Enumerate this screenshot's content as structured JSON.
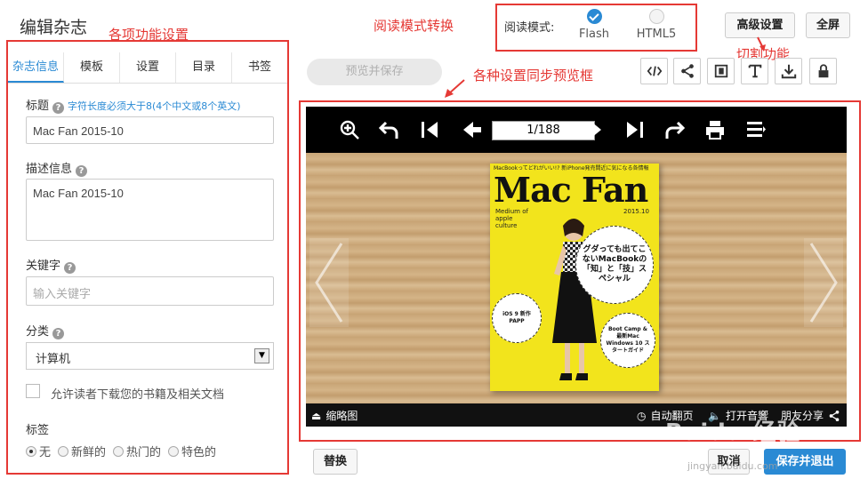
{
  "header": {
    "title": "编辑杂志",
    "advanced_settings": "高级设置",
    "fullscreen": "全屏"
  },
  "annotations": {
    "settings": "各项功能设置",
    "read_mode_switch": "阅读模式转换",
    "preview_sync": "各种设置同步预览框",
    "cut_function": "切割功能"
  },
  "read_mode": {
    "label": "阅读模式:",
    "options": [
      {
        "label": "Flash",
        "checked": true
      },
      {
        "label": "HTML5",
        "checked": false
      }
    ]
  },
  "tabs": [
    {
      "label": "杂志信息",
      "active": true
    },
    {
      "label": "模板",
      "active": false
    },
    {
      "label": "设置",
      "active": false
    },
    {
      "label": "目录",
      "active": false
    },
    {
      "label": "书签",
      "active": false
    }
  ],
  "form": {
    "title_label": "标题",
    "title_hint": "字符长度必须大于8(4个中文或8个英文)",
    "title_value": "Mac Fan 2015-10",
    "desc_label": "描述信息",
    "desc_value": "Mac Fan 2015-10",
    "keyword_label": "关键字",
    "keyword_placeholder": "输入关键字",
    "category_label": "分类",
    "category_value": "计算机",
    "allow_download": "允许读者下载您的书籍及相关文档",
    "tag_label": "标签",
    "tag_options": [
      "无",
      "新鲜的",
      "热门的",
      "特色的"
    ]
  },
  "toolbar": {
    "preview_save": "预览并保存"
  },
  "viewer": {
    "page_counter": "1/188",
    "thumbnails": "缩略图",
    "auto_flip": "自动翻页",
    "open_sound": "打开音響",
    "share": "朋友分享"
  },
  "magazine": {
    "top_line": "MacBookってどれがいい!? 新iPhone発売間近に気になる各情報",
    "title": "Mac Fan",
    "subtitle": "Medium of apple culture",
    "date": "2015.10",
    "circle_main": "グダっても出てこないMacBookの「知」と「技」スペシャル",
    "circle_left": "iOS 9 新作PAPP",
    "circle_right": "Boot Camp & 最新Mac Windows 10 スタートガイド"
  },
  "footer": {
    "replace": "替换",
    "cancel": "取消",
    "save_exit": "保存并退出"
  },
  "watermark": {
    "text": "Baidu 经验",
    "url": "jingyan.baidu.com"
  },
  "colors": {
    "accent": "#2a8ad4",
    "annotation": "#e53935"
  }
}
